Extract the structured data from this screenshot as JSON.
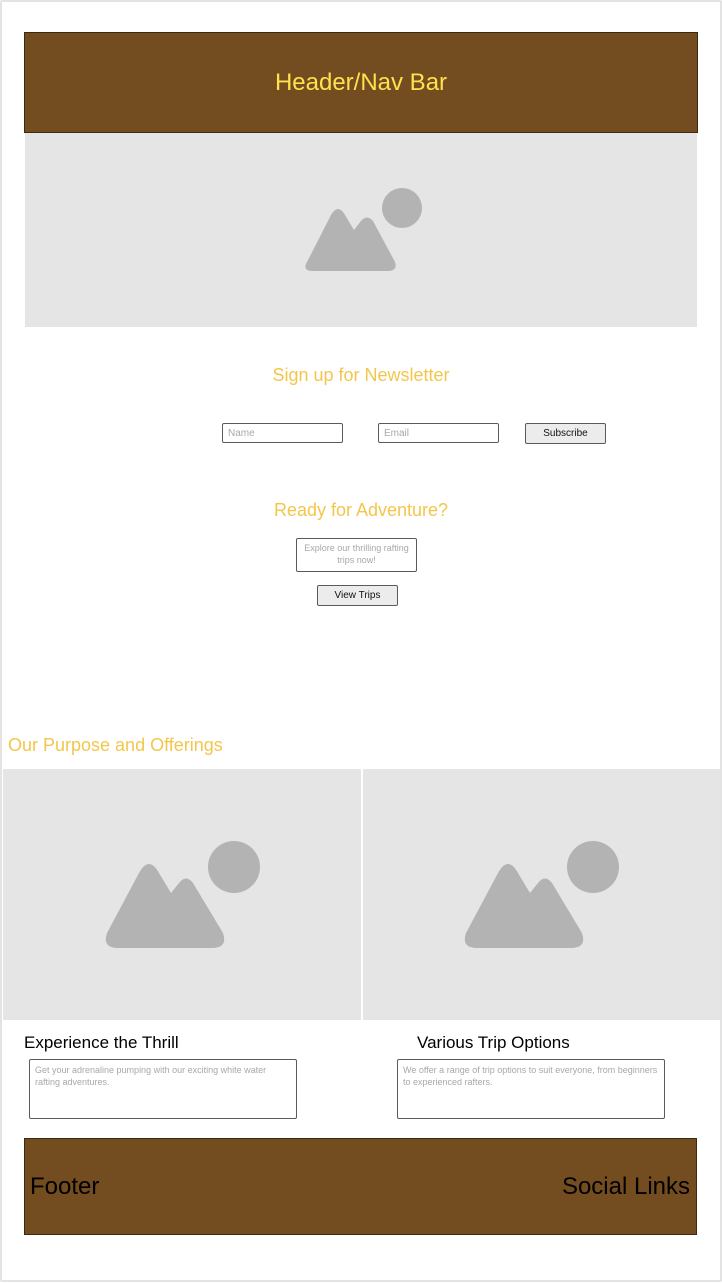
{
  "header": {
    "title": "Header/Nav Bar"
  },
  "newsletter": {
    "title": "Sign up for Newsletter",
    "name_placeholder": "Name",
    "email_placeholder": "Email",
    "subscribe_label": "Subscribe"
  },
  "adventure": {
    "title": "Ready for Adventure?",
    "description": "Explore our thrilling rafting trips now!",
    "view_trips_label": "View Trips"
  },
  "offerings": {
    "title": "Our Purpose and Offerings",
    "cards": [
      {
        "title": "Experience the Thrill",
        "description": "Get your adrenaline pumping with our exciting white water rafting adventures."
      },
      {
        "title": "Various Trip Options",
        "description": "We offer a range of trip options to suit everyone, from beginners to experienced rafters."
      }
    ]
  },
  "footer": {
    "left_label": "Footer",
    "right_label": "Social Links"
  },
  "colors": {
    "brand_brown": "#734c1f",
    "header_text": "#ffe14d",
    "accent_yellow": "#f3c64b",
    "placeholder_gray": "#e5e5e5"
  },
  "icons": [
    "image-placeholder-icon"
  ]
}
